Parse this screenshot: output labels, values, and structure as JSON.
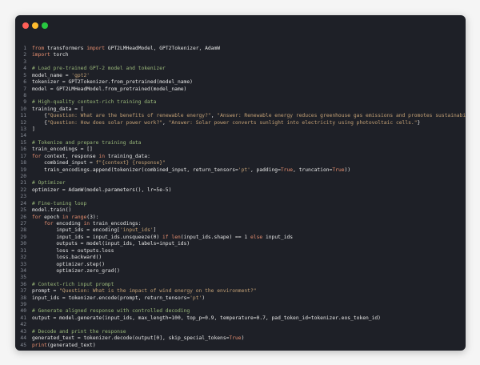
{
  "window": {
    "controls": [
      {
        "name": "close",
        "color": "#ff5f57"
      },
      {
        "name": "minimize",
        "color": "#febc2e"
      },
      {
        "name": "zoom",
        "color": "#28c840"
      }
    ]
  },
  "colors": {
    "background": "#1e2027",
    "text": "#e6e6e6",
    "keyword": "#e88f70",
    "comment": "#9ab87a",
    "string": "#c3a075",
    "line_number": "#8a8f99"
  },
  "code_lines": [
    {
      "n": "1",
      "t": [
        [
          "kw",
          "from"
        ],
        [
          "p",
          " transformers "
        ],
        [
          "kw",
          "import"
        ],
        [
          "p",
          " GPT2LMHeadModel, GPT2Tokenizer, AdamW"
        ]
      ]
    },
    {
      "n": "2",
      "t": [
        [
          "kw",
          "import"
        ],
        [
          "p",
          " torch"
        ]
      ]
    },
    {
      "n": "3",
      "t": []
    },
    {
      "n": "4",
      "t": [
        [
          "cm",
          "# Load pre-trained GPT-2 model and tokenizer"
        ]
      ]
    },
    {
      "n": "5",
      "t": [
        [
          "p",
          "model_name = "
        ],
        [
          "st",
          "'gpt2'"
        ]
      ]
    },
    {
      "n": "6",
      "t": [
        [
          "p",
          "tokenizer = GPT2Tokenizer.from_pretrained(model_name)"
        ]
      ]
    },
    {
      "n": "7",
      "t": [
        [
          "p",
          "model = GPT2LMHeadModel.from_pretrained(model_name)"
        ]
      ]
    },
    {
      "n": "8",
      "t": []
    },
    {
      "n": "9",
      "t": [
        [
          "cm",
          "# High-quality context-rich training data"
        ]
      ]
    },
    {
      "n": "10",
      "t": [
        [
          "p",
          "training_data = ["
        ]
      ]
    },
    {
      "n": "11",
      "t": [
        [
          "p",
          "    {"
        ],
        [
          "st",
          "\"Question: What are the benefits of renewable energy?\""
        ],
        [
          "p",
          ", "
        ],
        [
          "st",
          "\"Answer: Renewable energy reduces greenhouse gas emissions and promotes sustainability.\""
        ],
        [
          "p",
          "},"
        ]
      ]
    },
    {
      "n": "12",
      "t": [
        [
          "p",
          "    {"
        ],
        [
          "st",
          "\"Question: How does solar power work?\""
        ],
        [
          "p",
          ", "
        ],
        [
          "st",
          "\"Answer: Solar power converts sunlight into electricity using photovoltaic cells.\""
        ],
        [
          "p",
          "}"
        ]
      ]
    },
    {
      "n": "13",
      "t": [
        [
          "p",
          "]"
        ]
      ]
    },
    {
      "n": "14",
      "t": []
    },
    {
      "n": "15",
      "t": [
        [
          "cm",
          "# Tokenize and prepare training data"
        ]
      ]
    },
    {
      "n": "16",
      "t": [
        [
          "p",
          "train_encodings = []"
        ]
      ]
    },
    {
      "n": "17",
      "t": [
        [
          "kw",
          "for"
        ],
        [
          "p",
          " context, response "
        ],
        [
          "kw",
          "in"
        ],
        [
          "p",
          " training_data:"
        ]
      ]
    },
    {
      "n": "18",
      "t": [
        [
          "p",
          "    combined_input = "
        ],
        [
          "st",
          "f\"{context} {response}\""
        ]
      ]
    },
    {
      "n": "19",
      "t": [
        [
          "p",
          "    train_encodings.append(tokenizer(combined_input, return_tensors="
        ],
        [
          "st",
          "'pt'"
        ],
        [
          "p",
          ", padding="
        ],
        [
          "kw",
          "True"
        ],
        [
          "p",
          ", truncation="
        ],
        [
          "kw",
          "True"
        ],
        [
          "p",
          "))"
        ]
      ]
    },
    {
      "n": "20",
      "t": []
    },
    {
      "n": "21",
      "t": [
        [
          "cm",
          "# Optimizer"
        ]
      ]
    },
    {
      "n": "22",
      "t": [
        [
          "p",
          "optimizer = AdamW(model.parameters(), lr=5e-5)"
        ]
      ]
    },
    {
      "n": "23",
      "t": []
    },
    {
      "n": "24",
      "t": [
        [
          "cm",
          "# Fine-tuning loop"
        ]
      ]
    },
    {
      "n": "25",
      "t": [
        [
          "p",
          "model.train()"
        ]
      ]
    },
    {
      "n": "26",
      "t": [
        [
          "kw",
          "for"
        ],
        [
          "p",
          " epoch "
        ],
        [
          "kw",
          "in"
        ],
        [
          "p",
          " "
        ],
        [
          "bi",
          "range"
        ],
        [
          "p",
          "(3):"
        ]
      ]
    },
    {
      "n": "27",
      "t": [
        [
          "p",
          "    "
        ],
        [
          "kw",
          "for"
        ],
        [
          "p",
          " encoding "
        ],
        [
          "kw",
          "in"
        ],
        [
          "p",
          " train_encodings:"
        ]
      ]
    },
    {
      "n": "28",
      "t": [
        [
          "p",
          "        input_ids = encoding["
        ],
        [
          "st",
          "'input_ids'"
        ],
        [
          "p",
          "]"
        ]
      ]
    },
    {
      "n": "29",
      "t": [
        [
          "p",
          "        input_ids = input_ids.unsqueeze(0) "
        ],
        [
          "kw",
          "if"
        ],
        [
          "p",
          " "
        ],
        [
          "bi",
          "len"
        ],
        [
          "p",
          "(input_ids.shape) == 1 "
        ],
        [
          "kw",
          "else"
        ],
        [
          "p",
          " input_ids"
        ]
      ]
    },
    {
      "n": "30",
      "t": [
        [
          "p",
          "        outputs = model(input_ids, labels=input_ids)"
        ]
      ]
    },
    {
      "n": "31",
      "t": [
        [
          "p",
          "        loss = outputs.loss"
        ]
      ]
    },
    {
      "n": "32",
      "t": [
        [
          "p",
          "        loss.backward()"
        ]
      ]
    },
    {
      "n": "33",
      "t": [
        [
          "p",
          "        optimizer.step()"
        ]
      ]
    },
    {
      "n": "34",
      "t": [
        [
          "p",
          "        optimizer.zero_grad()"
        ]
      ]
    },
    {
      "n": "35",
      "t": []
    },
    {
      "n": "36",
      "t": [
        [
          "cm",
          "# Context-rich input prompt"
        ]
      ]
    },
    {
      "n": "37",
      "t": [
        [
          "p",
          "prompt = "
        ],
        [
          "st",
          "\"Question: What is the impact of wind energy on the environment?\""
        ]
      ]
    },
    {
      "n": "38",
      "t": [
        [
          "p",
          "input_ids = tokenizer.encode(prompt, return_tensors="
        ],
        [
          "st",
          "'pt'"
        ],
        [
          "p",
          ")"
        ]
      ]
    },
    {
      "n": "39",
      "t": []
    },
    {
      "n": "40",
      "t": [
        [
          "cm",
          "# Generate aligned response with controlled decoding"
        ]
      ]
    },
    {
      "n": "41",
      "t": [
        [
          "p",
          "output = model.generate(input_ids, max_length=100, top_p=0.9, temperature=0.7, pad_token_id=tokenizer.eos_token_id)"
        ]
      ]
    },
    {
      "n": "42",
      "t": []
    },
    {
      "n": "43",
      "t": [
        [
          "cm",
          "# Decode and print the response"
        ]
      ]
    },
    {
      "n": "44",
      "t": [
        [
          "p",
          "generated_text = tokenizer.decode(output[0], skip_special_tokens="
        ],
        [
          "kw",
          "True"
        ],
        [
          "p",
          ")"
        ]
      ]
    },
    {
      "n": "45",
      "t": [
        [
          "bi",
          "print"
        ],
        [
          "p",
          "(generated_text)"
        ]
      ]
    }
  ]
}
